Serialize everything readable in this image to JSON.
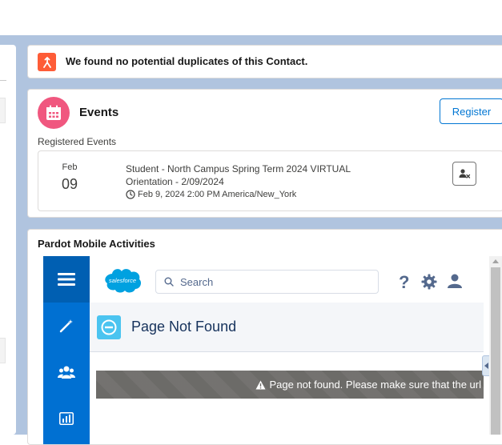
{
  "duplicates": {
    "message": "We found no potential duplicates of this Contact.",
    "icon": "merge-icon",
    "icon_color": "#fe5c37"
  },
  "events": {
    "title": "Events",
    "register_label": "Register",
    "registered_label": "Registered Events",
    "icon": "calendar-icon",
    "icon_color": "#f0577f",
    "items": [
      {
        "month": "Feb",
        "day": "09",
        "name": "Student - North Campus Spring Term 2024 VIRTUAL Orientation - 2/09/2024",
        "datetime": "Feb 9, 2024 2:00 PM America/New_York",
        "action_icon": "unregister-user-icon"
      }
    ]
  },
  "pardot": {
    "title": "Pardot Mobile Activities",
    "embedded": {
      "brand": "salesforce",
      "search_placeholder": "Search",
      "help_glyph": "?",
      "page_title": "Page Not Found",
      "alert_text": "Page not found. Please make sure that the url is",
      "nav_icons": [
        "menu-icon",
        "magic-wand-icon",
        "people-icon",
        "report-icon"
      ],
      "accent_color": "#0070d2"
    }
  }
}
